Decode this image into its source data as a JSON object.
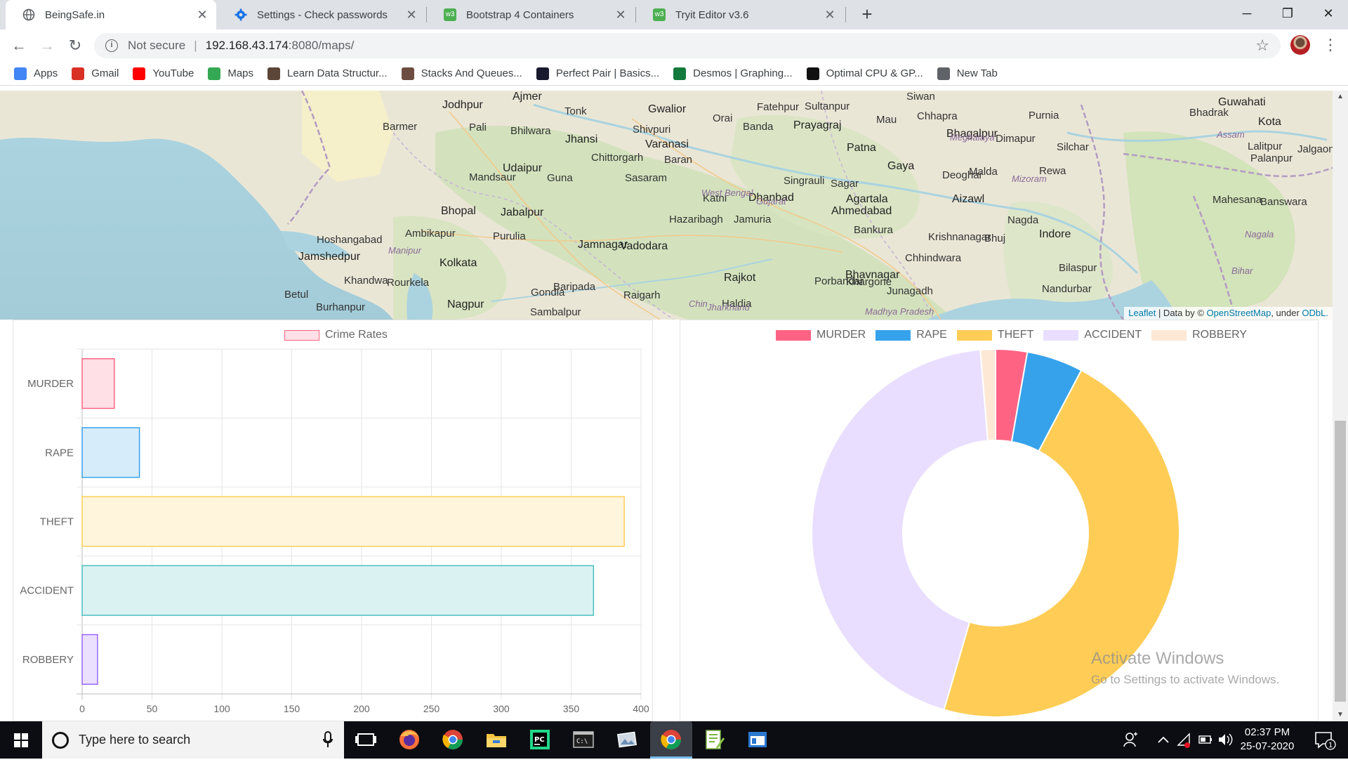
{
  "browser": {
    "tabs": [
      {
        "title": "BeingSafe.in",
        "icon": "globe-icon"
      },
      {
        "title": "Settings - Check passwords",
        "icon": "gear-icon"
      },
      {
        "title": "Bootstrap 4 Containers",
        "icon": "w3-icon"
      },
      {
        "title": "Tryit Editor v3.6",
        "icon": "w3-icon"
      }
    ],
    "new_tab": "+",
    "window_controls": {
      "minimize": "─",
      "maximize": "❐",
      "close": "✕"
    },
    "security_label": "Not secure",
    "url_host": "192.168.43.174",
    "url_path": ":8080/maps/",
    "bookmarks": [
      {
        "label": "Apps",
        "icon": "apps-grid-icon",
        "color": "#4285f4"
      },
      {
        "label": "Gmail",
        "icon": "gmail-icon",
        "color": "#d93025"
      },
      {
        "label": "YouTube",
        "icon": "youtube-icon",
        "color": "#ff0000"
      },
      {
        "label": "Maps",
        "icon": "maps-icon",
        "color": "#34a853"
      },
      {
        "label": "Learn Data Structur...",
        "icon": "codechef-icon",
        "color": "#5b4638"
      },
      {
        "label": "Stacks And Queues...",
        "icon": "book-icon",
        "color": "#6d4c41"
      },
      {
        "label": "Perfect Pair | Basics...",
        "icon": "hackerrank-icon",
        "color": "#1a1a2e"
      },
      {
        "label": "Desmos | Graphing...",
        "icon": "desmos-icon",
        "color": "#127a3d"
      },
      {
        "label": "Optimal CPU & GP...",
        "icon": "rc-icon",
        "color": "#111111"
      },
      {
        "label": "New Tab",
        "icon": "globe-icon",
        "color": "#5f6368"
      }
    ]
  },
  "map": {
    "labels": [
      {
        "text": "Jodhpur",
        "cls": "big"
      },
      {
        "text": "Ajmer",
        "cls": "big"
      },
      {
        "text": "Tonk",
        "cls": ""
      },
      {
        "text": "Gwalior",
        "cls": "big"
      },
      {
        "text": "Orai",
        "cls": ""
      },
      {
        "text": "Fatehpur",
        "cls": ""
      },
      {
        "text": "Sultanpur",
        "cls": ""
      },
      {
        "text": "Siwan",
        "cls": ""
      },
      {
        "text": "Guwahati",
        "cls": "big"
      },
      {
        "text": "Barmer",
        "cls": ""
      },
      {
        "text": "Pali",
        "cls": ""
      },
      {
        "text": "Bhilwara",
        "cls": ""
      },
      {
        "text": "Shivpuri",
        "cls": ""
      },
      {
        "text": "Banda",
        "cls": ""
      },
      {
        "text": "Prayagraj",
        "cls": "big"
      },
      {
        "text": "Mau",
        "cls": ""
      },
      {
        "text": "Chhapra",
        "cls": ""
      },
      {
        "text": "Purnia",
        "cls": ""
      },
      {
        "text": "Kota",
        "cls": "big"
      },
      {
        "text": "Jhansi",
        "cls": "big"
      },
      {
        "text": "Varanasi",
        "cls": "big"
      },
      {
        "text": "Patna",
        "cls": "big"
      },
      {
        "text": "Bhagalpur",
        "cls": "big"
      },
      {
        "text": "Dimapur",
        "cls": ""
      },
      {
        "text": "Lalitpur",
        "cls": ""
      },
      {
        "text": "Baran",
        "cls": ""
      },
      {
        "text": "Chittorgarh",
        "cls": ""
      },
      {
        "text": "Udaipur",
        "cls": "big"
      },
      {
        "text": "Mandsaur",
        "cls": ""
      },
      {
        "text": "Guna",
        "cls": ""
      },
      {
        "text": "Sasaram",
        "cls": ""
      },
      {
        "text": "Gaya",
        "cls": "big"
      },
      {
        "text": "Deoghar",
        "cls": ""
      },
      {
        "text": "Malda",
        "cls": ""
      },
      {
        "text": "Silchar",
        "cls": ""
      },
      {
        "text": "Palanpur",
        "cls": ""
      },
      {
        "text": "Rewa",
        "cls": ""
      },
      {
        "text": "Singrauli",
        "cls": ""
      },
      {
        "text": "Sagar",
        "cls": ""
      },
      {
        "text": "Katni",
        "cls": ""
      },
      {
        "text": "Dhanbad",
        "cls": "big"
      },
      {
        "text": "Agartala",
        "cls": "big"
      },
      {
        "text": "Aizawl",
        "cls": "big"
      },
      {
        "text": "Mahesana",
        "cls": ""
      },
      {
        "text": "Banswara",
        "cls": ""
      },
      {
        "text": "Bhopal",
        "cls": "big"
      },
      {
        "text": "Jabalpur",
        "cls": "big"
      },
      {
        "text": "Hazaribagh",
        "cls": ""
      },
      {
        "text": "Jamuria",
        "cls": ""
      },
      {
        "text": "Ahmedabad",
        "cls": "big"
      },
      {
        "text": "Nagda",
        "cls": ""
      },
      {
        "text": "Ambikapur",
        "cls": ""
      },
      {
        "text": "Purulia",
        "cls": ""
      },
      {
        "text": "Bankura",
        "cls": ""
      },
      {
        "text": "Krishnanagar",
        "cls": ""
      },
      {
        "text": "Bhuj",
        "cls": ""
      },
      {
        "text": "Indore",
        "cls": "big"
      },
      {
        "text": "Hoshangabad",
        "cls": ""
      },
      {
        "text": "Jamnagar",
        "cls": "big"
      },
      {
        "text": "Vadodara",
        "cls": "big"
      },
      {
        "text": "Jamshedpur",
        "cls": "big"
      },
      {
        "text": "Kolkata",
        "cls": "big"
      },
      {
        "text": "Chhindwara",
        "cls": ""
      },
      {
        "text": "Bilaspur",
        "cls": ""
      },
      {
        "text": "Rajkot",
        "cls": "big"
      },
      {
        "text": "Bhavnagar",
        "cls": "big"
      },
      {
        "text": "Khandwa",
        "cls": ""
      },
      {
        "text": "Rourkela",
        "cls": ""
      },
      {
        "text": "Baripada",
        "cls": ""
      },
      {
        "text": "Porbandar",
        "cls": ""
      },
      {
        "text": "Khargone",
        "cls": ""
      },
      {
        "text": "Betul",
        "cls": ""
      },
      {
        "text": "Gondia",
        "cls": ""
      },
      {
        "text": "Raigarh",
        "cls": ""
      },
      {
        "text": "Haldia",
        "cls": ""
      },
      {
        "text": "Junagadh",
        "cls": ""
      },
      {
        "text": "Nandurbar",
        "cls": ""
      },
      {
        "text": "Burhanpur",
        "cls": ""
      },
      {
        "text": "Nagpur",
        "cls": "big"
      },
      {
        "text": "Sambalpur",
        "cls": ""
      },
      {
        "text": "Chin",
        "cls": "state"
      },
      {
        "text": "Madhya Pradesh",
        "cls": "state"
      },
      {
        "text": "Jharkhand",
        "cls": "state"
      },
      {
        "text": "Bihar",
        "cls": "state"
      },
      {
        "text": "West Bengal",
        "cls": "state"
      },
      {
        "text": "Gujarat",
        "cls": "state"
      },
      {
        "text": "Meghalaya",
        "cls": "state"
      },
      {
        "text": "Mizoram",
        "cls": "state"
      },
      {
        "text": "Manipur",
        "cls": "state"
      },
      {
        "text": "Assam",
        "cls": "state"
      },
      {
        "text": "Nagala",
        "cls": "state"
      },
      {
        "text": "Jalgaon",
        "cls": ""
      },
      {
        "text": "Bhadrak",
        "cls": ""
      }
    ],
    "attribution": {
      "leaflet": "Leaflet",
      "data_by": " | Data by © ",
      "osm": "OpenStreetMap",
      "under": ", under ",
      "odbl": "ODbL."
    }
  },
  "chart_data": [
    {
      "type": "bar",
      "orientation": "horizontal",
      "categories": [
        "MURDER",
        "RAPE",
        "THEFT",
        "ACCIDENT",
        "ROBBERY"
      ],
      "series": [
        {
          "name": "Crime Rates",
          "values": [
            23,
            41,
            388,
            366,
            11
          ]
        }
      ],
      "xlim": [
        0,
        400
      ],
      "xticks": [
        0,
        50,
        100,
        150,
        200,
        250,
        300,
        350,
        400
      ],
      "grid": true,
      "legend": "top",
      "colors": {
        "fills": [
          "#ffe0e6",
          "#d7ecfb",
          "#fff5dd",
          "#dbf2f2",
          "#ebe0ff"
        ],
        "borders": [
          "#ff6384",
          "#36a2eb",
          "#ffce56",
          "#4bc0c0",
          "#9966ff"
        ]
      }
    },
    {
      "type": "pie",
      "variant": "doughnut",
      "labels": [
        "MURDER",
        "RAPE",
        "THEFT",
        "ACCIDENT",
        "ROBBERY"
      ],
      "values": [
        23,
        41,
        388,
        366,
        11
      ],
      "legend": "top",
      "colors": [
        "#ff6384",
        "#36a2eb",
        "#ffcd56",
        "#e9deff",
        "#fde8d6"
      ]
    }
  ],
  "watermark": {
    "line1": "Activate Windows",
    "line2": "Go to Settings to activate Windows."
  },
  "taskbar": {
    "search_placeholder": "Type here to search",
    "time": "02:37 PM",
    "date": "25-07-2020",
    "notification_count": "1",
    "apps": [
      "task-view-icon",
      "firefox-icon",
      "chrome-icon",
      "file-explorer-icon",
      "pycharm-icon",
      "terminal-icon",
      "photos-icon",
      "chrome-active-icon",
      "notepadpp-icon",
      "app-window-icon"
    ]
  }
}
